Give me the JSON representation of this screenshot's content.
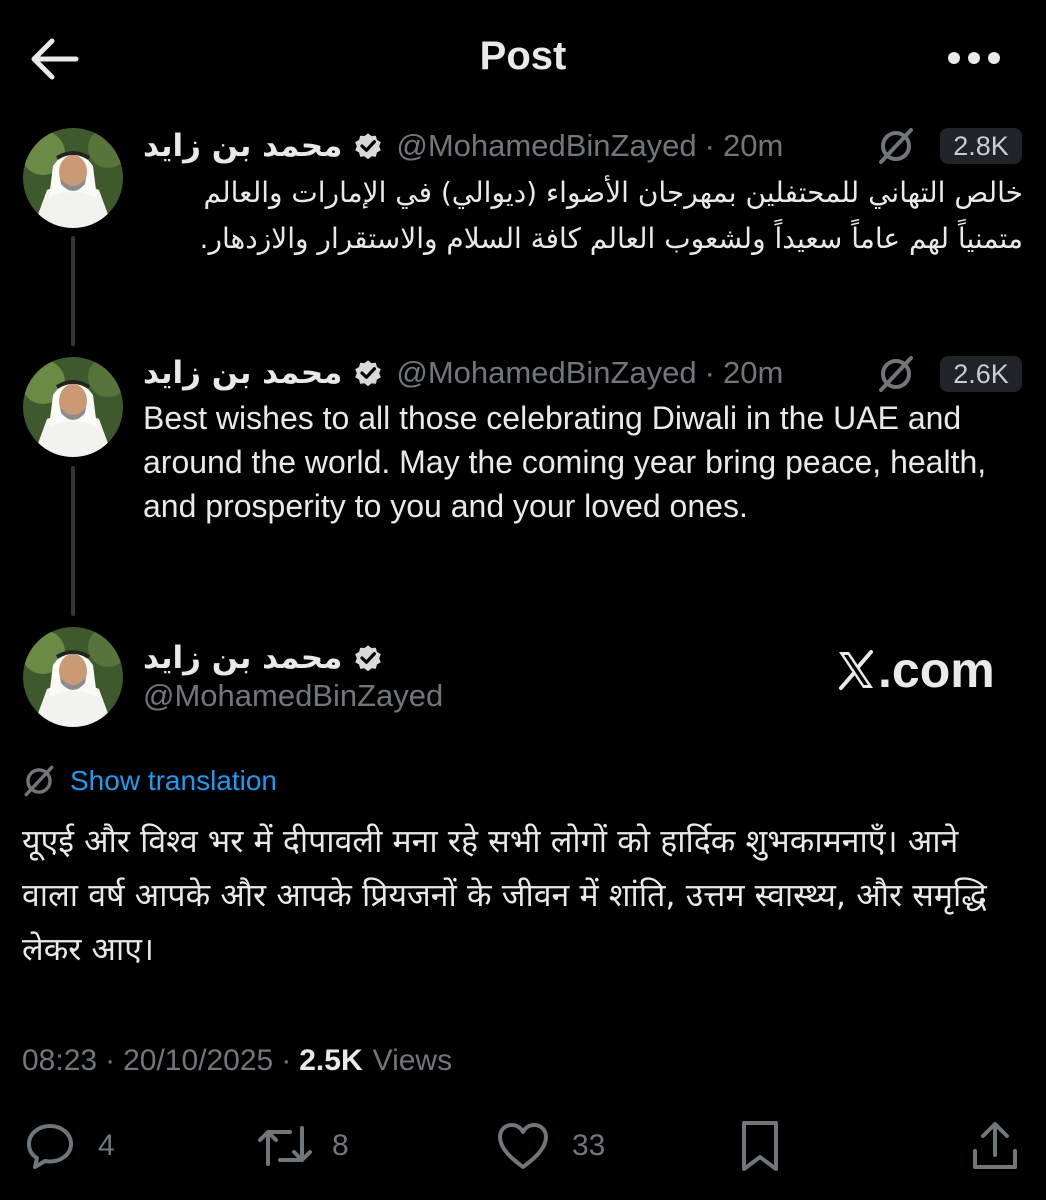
{
  "header": {
    "title": "Post"
  },
  "posts": [
    {
      "name": "محمد بن زايد",
      "handle": "@MohamedBinZayed",
      "separator": "·",
      "time": "20m",
      "count": "2.8K",
      "text": "خالص التهاني للمحتفلين بمهرجان الأضواء (ديوالي) في الإمارات والعالم متمنياً لهم عاماً سعيداً ولشعوب العالم كافة السلام والاستقرار والازدهار."
    },
    {
      "name": "محمد بن زايد",
      "handle": "@MohamedBinZayed",
      "separator": "·",
      "time": "20m",
      "count": "2.6K",
      "text": "Best wishes to all those celebrating Diwali in the UAE and around the world. May the coming year bring peace, health, and prosperity to you and your loved ones."
    }
  ],
  "main": {
    "name": "محمد بن زايد",
    "handle": "@MohamedBinZayed",
    "watermark": ".com",
    "translate_label": "Show translation",
    "text": "यूएई और विश्व भर में दीपावली मना रहे सभी लोगों को हार्दिक शुभकामनाएँ। आने वाला वर्ष आपके और आपके प्रियजनों के जीवन में शांति, उत्तम स्वास्थ्य, और समृद्धि लेकर आए।",
    "time": "08:23",
    "date": "20/10/2025",
    "separator": "·",
    "views_count": "2.5K",
    "views_label": "Views"
  },
  "actions": {
    "replies": "4",
    "reposts": "8",
    "likes": "33"
  },
  "icons": [
    "back-arrow-icon",
    "more-icon",
    "verified-badge-icon",
    "grok-icon",
    "x-logo-icon",
    "reply-icon",
    "repost-icon",
    "like-icon",
    "bookmark-icon",
    "share-icon"
  ],
  "colors": {
    "background": "#000000",
    "text": "#e7e9ea",
    "secondary": "#71767b",
    "link": "#1d9bf0",
    "badge_bg": "#202327"
  }
}
